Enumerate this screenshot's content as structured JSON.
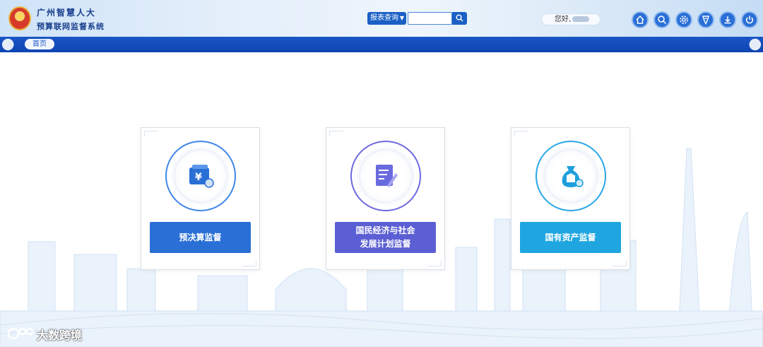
{
  "header": {
    "title_line1": "广州智慧人大",
    "title_line2": "预算联网监督系统",
    "report_query_label": "报表查询",
    "search_placeholder": "",
    "greeting": "您好,"
  },
  "header_icons": [
    "home-icon",
    "search-icon",
    "settings-icon",
    "badge-icon",
    "download-icon",
    "power-icon"
  ],
  "nav": {
    "home_tab": "首页"
  },
  "cards": [
    {
      "label": "预决算监督",
      "color": "#2a6fd6",
      "ring": "#3f86e8",
      "icon": "money-icon"
    },
    {
      "label": "国民经济与社会\n发展计划监督",
      "color": "#5b5fd3",
      "ring": "#6e6ae0",
      "icon": "document-edit-icon"
    },
    {
      "label": "国有资产监督",
      "color": "#1fa6e0",
      "ring": "#29a7e6",
      "icon": "money-bag-icon"
    }
  ],
  "watermark": "大数跨境",
  "colors": {
    "nav": "#1a56c6",
    "header_bg": "#e4effa",
    "skyline": "#dce9f7"
  }
}
